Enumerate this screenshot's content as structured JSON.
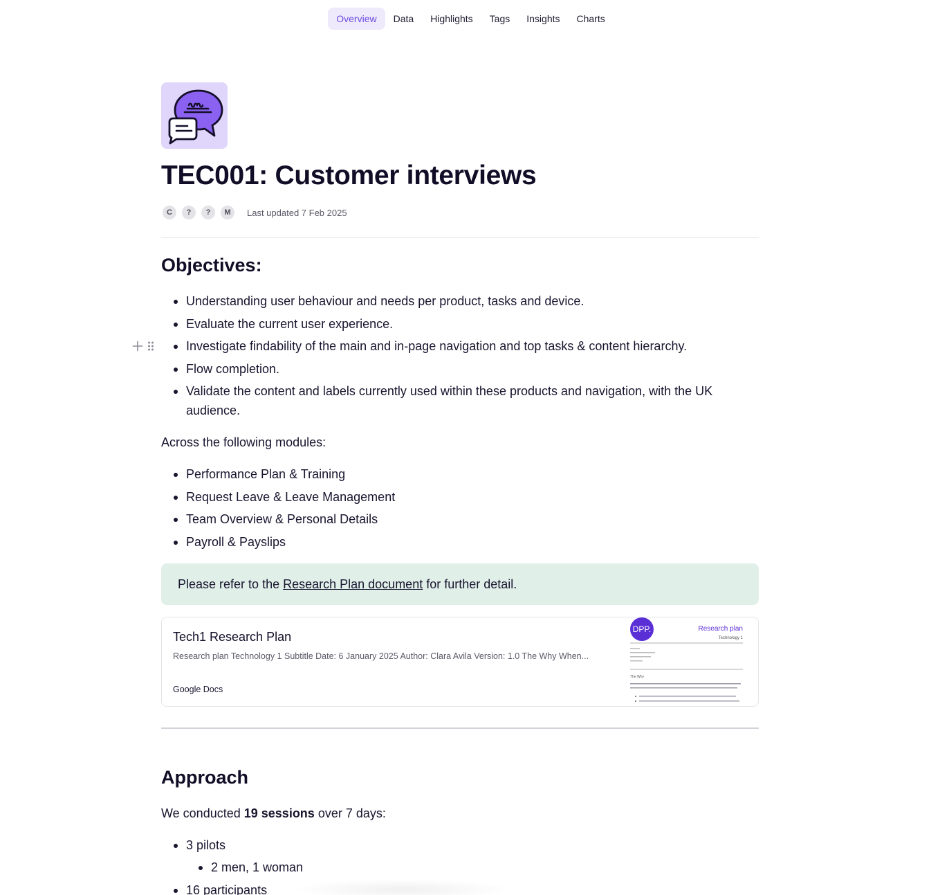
{
  "nav": {
    "tabs": [
      {
        "label": "Overview",
        "active": true
      },
      {
        "label": "Data"
      },
      {
        "label": "Highlights"
      },
      {
        "label": "Tags"
      },
      {
        "label": "Insights"
      },
      {
        "label": "Charts"
      }
    ]
  },
  "header": {
    "logo_icon": "chat-bubbles-icon",
    "title": "TEC001: Customer interviews",
    "avatars": [
      "C",
      "?",
      "?",
      "M"
    ],
    "last_updated": "Last updated 7 Feb 2025"
  },
  "objectives": {
    "heading": "Objectives:",
    "items": [
      "Understanding user behaviour and needs per product, tasks and device.",
      "Evaluate the current user experience.",
      "Investigate findability of the main and in-page navigation and top tasks & content hierarchy.",
      "Flow completion.",
      "Validate the content and labels currently used within these products and navigation, with the UK audience."
    ]
  },
  "modules": {
    "intro": "Across the following modules:",
    "items": [
      "Performance Plan & Training",
      "Request Leave & Leave Management",
      "Team Overview & Personal Details",
      "Payroll & Payslips"
    ]
  },
  "callout": {
    "prefix": "Please refer to the ",
    "link": "Research Plan document",
    "suffix": " for further detail."
  },
  "card": {
    "title": "Tech1 Research Plan",
    "description": "Research plan Technology 1 Subtitle Date: 6 January 2025 Author: Clara Avila Version: 1.0 The Why When...",
    "source": "Google Docs",
    "thumb": {
      "badge": "DPP.",
      "heading": "Research plan",
      "subheading": "Technology 1",
      "section": "The Why"
    }
  },
  "approach": {
    "heading": "Approach",
    "sentence_prefix": "We conducted ",
    "sentence_bold": "19 sessions",
    "sentence_suffix": " over 7 days:",
    "items": [
      "3 pilots",
      "16 participants"
    ],
    "sub_items": [
      "2 men, 1 woman"
    ]
  },
  "colors": {
    "accent": "#6a4de0",
    "callout_bg": "#e1efe9",
    "logo_bg": "#e0d6fb"
  }
}
